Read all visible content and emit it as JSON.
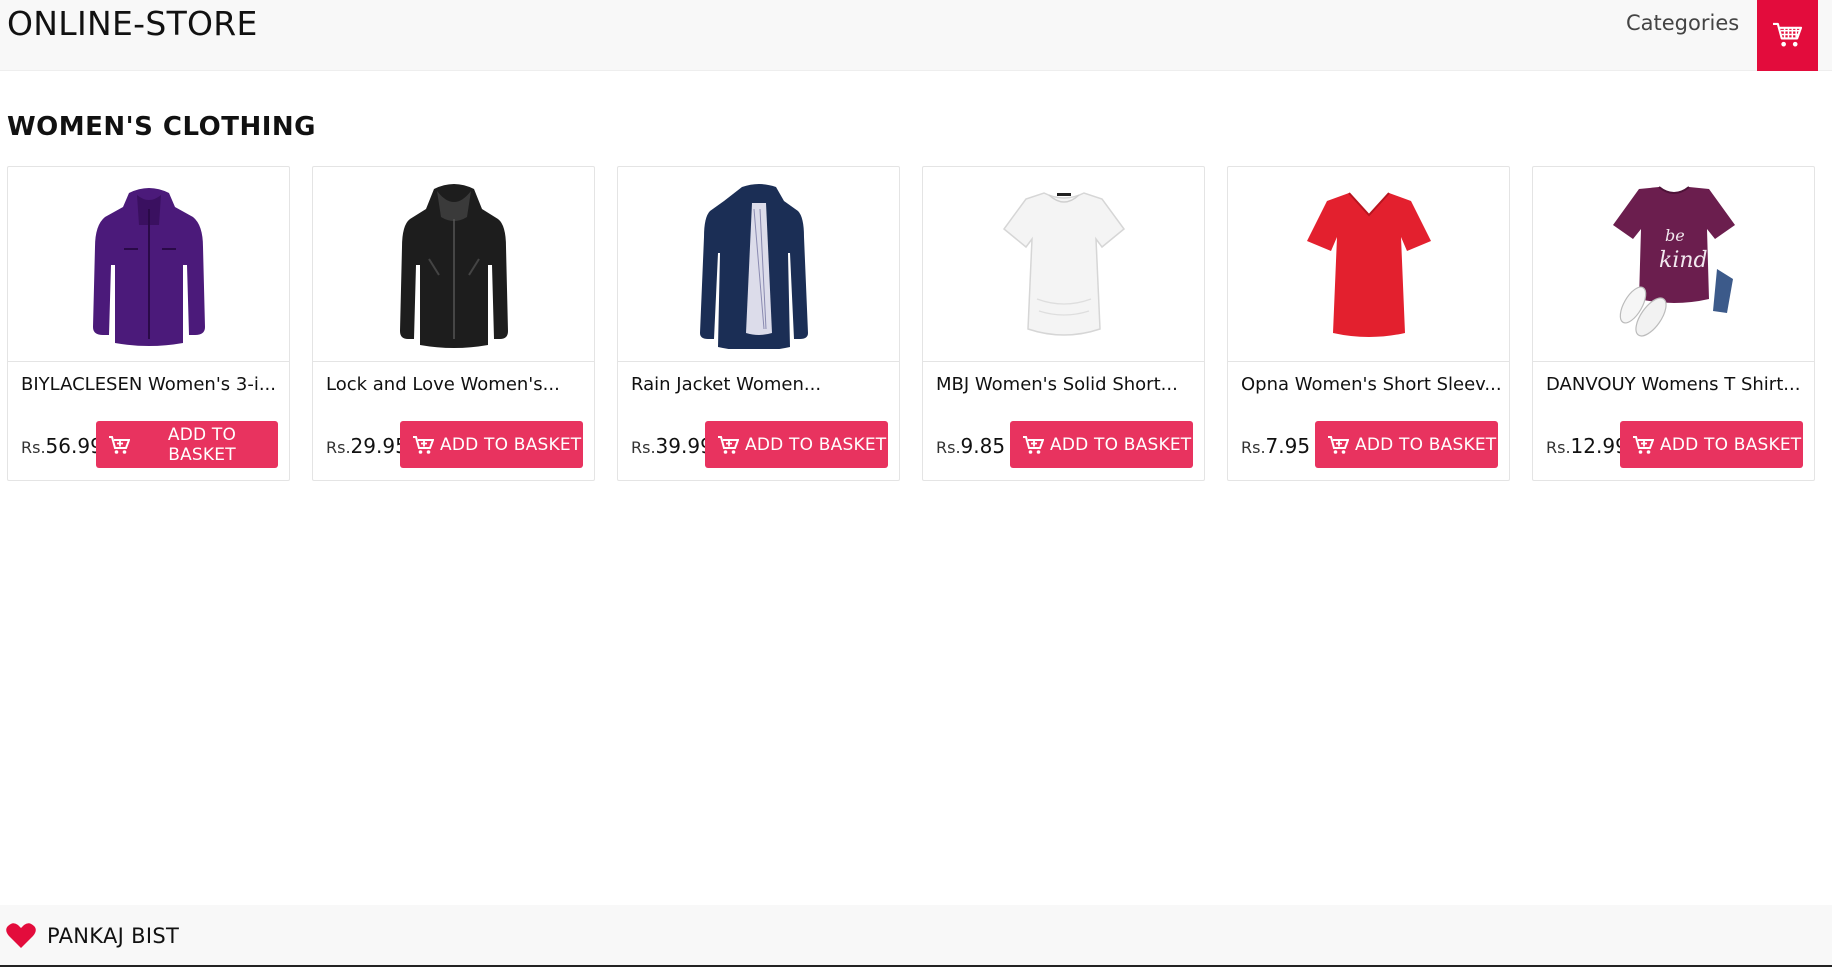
{
  "header": {
    "brand": "ONLINE-STORE",
    "nav_categories": "Categories",
    "cart_icon": "shopping-cart-icon",
    "accent_color": "#e30c3c"
  },
  "section": {
    "title": "WOMEN'S CLOTHING"
  },
  "products": [
    {
      "title": "BIYLACLESEN Women's 3-i...",
      "currency": "Rs.",
      "price": "56.99",
      "button": "ADD TO BASKET",
      "image": "purple-jacket"
    },
    {
      "title": "Lock and Love Women's...",
      "currency": "Rs.",
      "price": "29.95",
      "button": "ADD TO BASKET",
      "image": "black-leather-jacket"
    },
    {
      "title": "Rain Jacket Women...",
      "currency": "Rs.",
      "price": "39.99",
      "button": "ADD TO BASKET",
      "image": "navy-rain-jacket"
    },
    {
      "title": "MBJ Women's Solid Short...",
      "currency": "Rs.",
      "price": "9.85",
      "button": "ADD TO BASKET",
      "image": "white-tshirt"
    },
    {
      "title": "Opna Women's Short Sleev...",
      "currency": "Rs.",
      "price": "7.95",
      "button": "ADD TO BASKET",
      "image": "red-tshirt"
    },
    {
      "title": "DANVOUY Womens T Shirt...",
      "currency": "Rs.",
      "price": "12.99",
      "button": "ADD TO BASKET",
      "image": "purple-be-kind-tshirt"
    }
  ],
  "footer": {
    "icon": "heart-icon",
    "author": "PANKAJ BIST"
  },
  "colors": {
    "button": "#e8335f",
    "cart_button": "#e30c3c",
    "nav_bg": "#f8f8f8"
  }
}
